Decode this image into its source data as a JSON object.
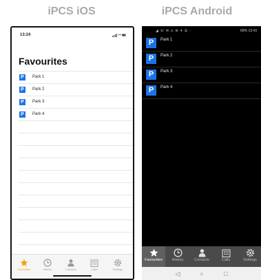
{
  "headings": {
    "ios": "iPCS iOS",
    "android": "iPCS Android"
  },
  "ios": {
    "status": {
      "time": "13:24",
      "icons": "signal-wifi-battery"
    },
    "title": "Favourites",
    "badge_letter": "P",
    "items": [
      "Park 1",
      "Park 2",
      "Park 3",
      "Park 4"
    ],
    "tabs": [
      {
        "label": "Favourites",
        "icon": "star-icon",
        "active": true
      },
      {
        "label": "History",
        "icon": "clock-icon",
        "active": false
      },
      {
        "label": "Contacts",
        "icon": "person-icon",
        "active": false
      },
      {
        "label": "Calls",
        "icon": "building-icon",
        "active": false
      },
      {
        "label": "Settings",
        "icon": "gear-icon",
        "active": false
      }
    ],
    "colors": {
      "accent": "#f39c12",
      "badge": "#1c73e6"
    }
  },
  "android": {
    "status": {
      "time": "13:43",
      "battery": "89%"
    },
    "badge_letter": "P",
    "items": [
      "Park 1",
      "Park 2",
      "Park 3",
      "Park 4"
    ],
    "tabs": [
      {
        "label": "Favourites",
        "icon": "star-icon",
        "active": true
      },
      {
        "label": "History",
        "icon": "clock-icon",
        "active": false
      },
      {
        "label": "Contacts",
        "icon": "person-icon",
        "active": false
      },
      {
        "label": "Calls",
        "icon": "building-icon",
        "active": false
      },
      {
        "label": "Settings",
        "icon": "gear-icon",
        "active": false
      }
    ],
    "nav": [
      "back-icon",
      "home-icon",
      "recents-icon"
    ],
    "colors": {
      "badge": "#1c73e6",
      "tabbar": "#4a4a4a"
    }
  }
}
